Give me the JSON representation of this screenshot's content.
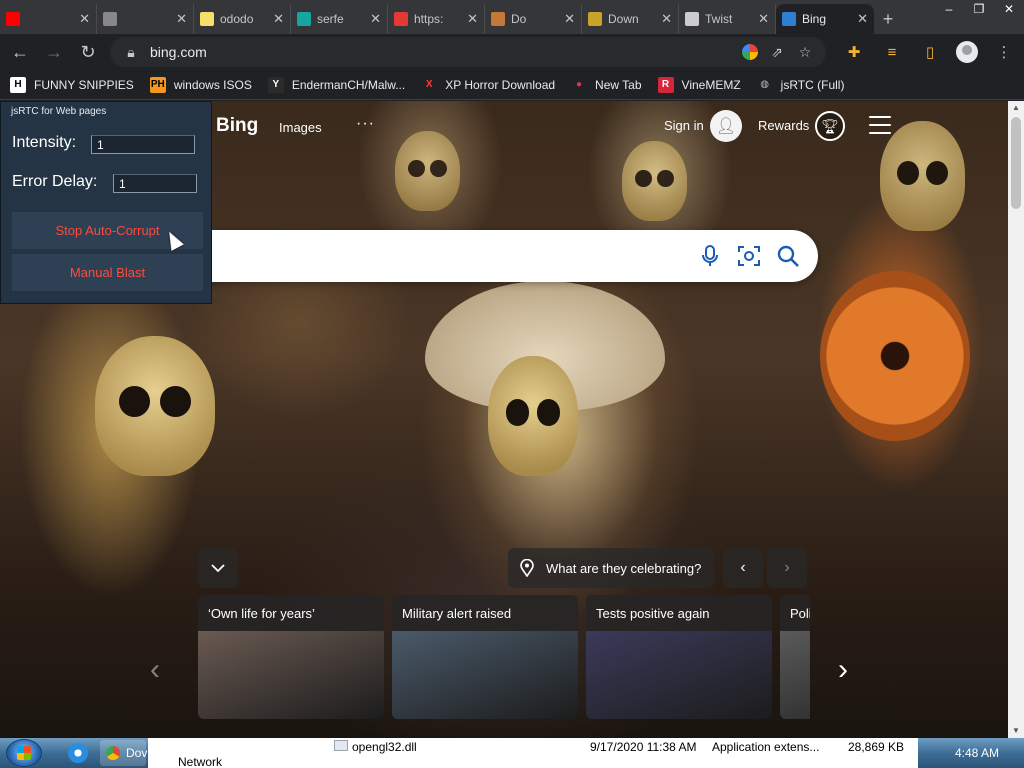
{
  "tabs": [
    {
      "title": "",
      "favicon_color": "#ff0000",
      "icon": "youtube-icon"
    },
    {
      "title": "",
      "favicon_color": "#888888",
      "icon": "page-icon"
    },
    {
      "title": "ododo",
      "favicon_color": "#f5e06a",
      "icon": "note-icon"
    },
    {
      "title": "serfe",
      "favicon_color": "#15a6a0",
      "icon": "diamond-icon"
    },
    {
      "title": "https:",
      "favicon_color": "#e53935",
      "icon": "warning-icon"
    },
    {
      "title": "Do",
      "favicon_color": "#c47a36",
      "icon": "page-icon"
    },
    {
      "title": "Down",
      "favicon_color": "#c9a227",
      "icon": "page-icon"
    },
    {
      "title": "Twist",
      "favicon_color": "#cccccc",
      "icon": "trash-icon"
    },
    {
      "title": "Bing",
      "favicon_color": "#2f7fd1",
      "icon": "bing-icon",
      "active": true
    }
  ],
  "window_controls": {
    "minimize": "–",
    "restore": "❐",
    "close": "✕"
  },
  "address": {
    "url": "bing.com"
  },
  "bookmarks": [
    {
      "label": "FUNNY SNIPPIES",
      "icon_text": "H",
      "color": "#ffffff",
      "text_color": "#000000"
    },
    {
      "label": "windows ISOS",
      "icon_text": "PH",
      "color": "#f7971d",
      "text_color": "#000000"
    },
    {
      "label": "EndermanCH/Malw...",
      "icon_text": "Y",
      "color": "#2b2b2b",
      "text_color": "#ffffff"
    },
    {
      "label": "XP Horror Download",
      "icon_text": "X",
      "color": "#202124",
      "text_color": "#ff3b30"
    },
    {
      "label": "New Tab",
      "icon_text": "●",
      "color": "#202124",
      "text_color": "#d35"
    },
    {
      "label": "VineMEMZ",
      "icon_text": "R",
      "color": "#d9253a",
      "text_color": "#ffffff"
    },
    {
      "label": "jsRTC (Full)",
      "icon_text": "◍",
      "color": "#202124",
      "text_color": "#bbbbbb"
    }
  ],
  "bing": {
    "logo": "Bing",
    "nav_images": "Images",
    "more": "···",
    "signin": "Sign in",
    "rewards": "Rewards",
    "search_placeholder": ""
  },
  "feed": {
    "caption": "What are they celebrating?",
    "cards": [
      {
        "title": "‘Own life for years’",
        "thumb_color": "#6a5a52"
      },
      {
        "title": "Military alert raised",
        "thumb_color": "#4a5a6a"
      },
      {
        "title": "Tests positive again",
        "thumb_color": "#3a3a5a"
      },
      {
        "title": "Poli",
        "thumb_color": "#5a5a5a"
      }
    ]
  },
  "jsrtc": {
    "title": "jsRTC for Web pages",
    "intensity_label": "Intensity:",
    "intensity_value": "1",
    "delay_label": "Error Delay:",
    "delay_value": "1",
    "stop_button": "Stop Auto-Corrupt",
    "blast_button": "Manual Blast"
  },
  "taskbar": {
    "chrome_label": "Dov",
    "clock": "4:48 AM",
    "explorer_rows": [
      {
        "nav": "",
        "name": "opengl32.dll",
        "date": "9/17/2020 11:38 AM",
        "type": "Application extens...",
        "size": "28,869 KB"
      },
      {
        "nav": "Network",
        "name": "",
        "date": "",
        "type": "",
        "size": ""
      }
    ]
  },
  "colors": {
    "jsrtc_panel": "#253445",
    "jsrtc_button_text": "#ff4b3a",
    "bing_blue": "#1a5bb5"
  }
}
